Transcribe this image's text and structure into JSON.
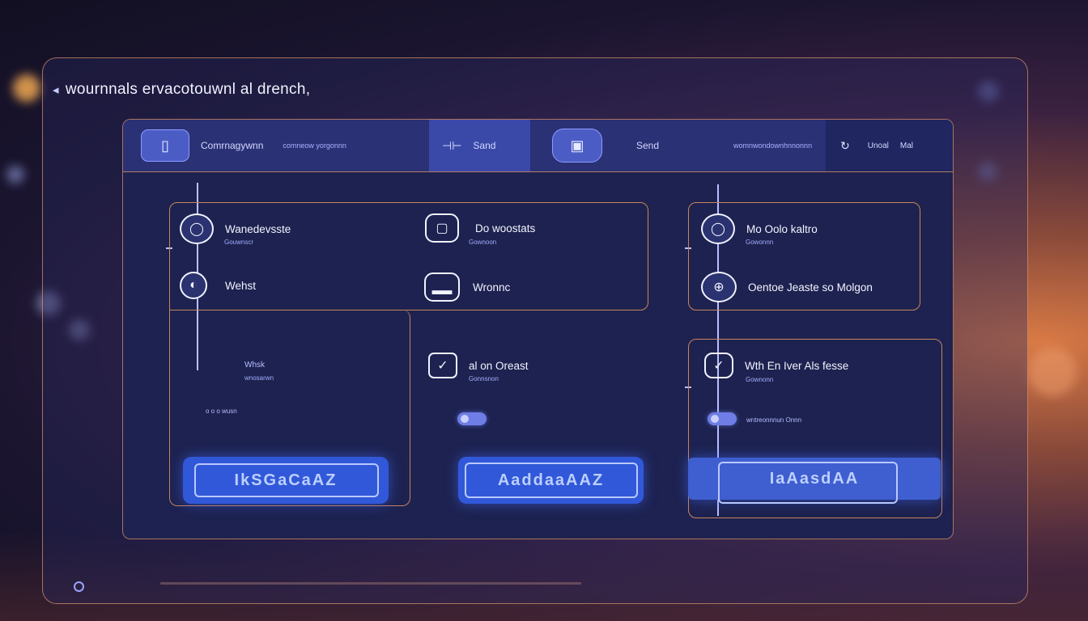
{
  "window": {
    "title": "wournnals ervacotouwnl al drench,",
    "back_icon": "back-arrow-icon"
  },
  "tabs": [
    {
      "label": "Comrnagywnn",
      "sub": "comneow yorgonnn",
      "icon": "device-icon"
    },
    {
      "label": "Sand",
      "icon": "slider-icon"
    },
    {
      "label": "Send",
      "icon": "phone-icon"
    },
    {
      "label": "womnwondownhnnonnn",
      "icon": "none"
    },
    {
      "label": "Unoal",
      "sub": "Mal",
      "icon": "refresh-icon"
    }
  ],
  "cards": {
    "top_left": [
      {
        "label": "Wanedevsste",
        "sub": "Gouwnscr",
        "icon": "message-icon"
      },
      {
        "label": "Wehst",
        "icon": "compass-icon"
      }
    ],
    "top_mid": [
      {
        "label": "Do woostats",
        "sub": "Gownoon",
        "icon": "square-icon"
      },
      {
        "label": "Wronnc",
        "icon": "bar-icon"
      }
    ],
    "top_right": [
      {
        "label": "Mo Oolo kaltro",
        "sub": "Gowonnn",
        "icon": "message-icon"
      },
      {
        "label": "Oentoe Jeaste so Molgon",
        "icon": "pin-icon"
      }
    ],
    "bottom_left": {
      "label": "Whsk",
      "sub": "wnosarwn",
      "tiny": "o o   o wusn"
    },
    "bottom_mid": {
      "label": "al on Oreast",
      "icon": "check-icon",
      "sub": "Gonnsnon"
    },
    "bottom_right": {
      "label": "Wth En Iver Als fesse",
      "sub": "Gownonn",
      "icon": "check-icon",
      "tiny": "wntreonnnun Onnn"
    }
  },
  "buttons": [
    {
      "label": "IkSGaCaAZ"
    },
    {
      "label": "AaddaaAAZ"
    },
    {
      "label": "IaAasdAA"
    }
  ],
  "colors": {
    "accent": "#3158d8",
    "border": "#c9845c",
    "panel": "#1d2250"
  }
}
